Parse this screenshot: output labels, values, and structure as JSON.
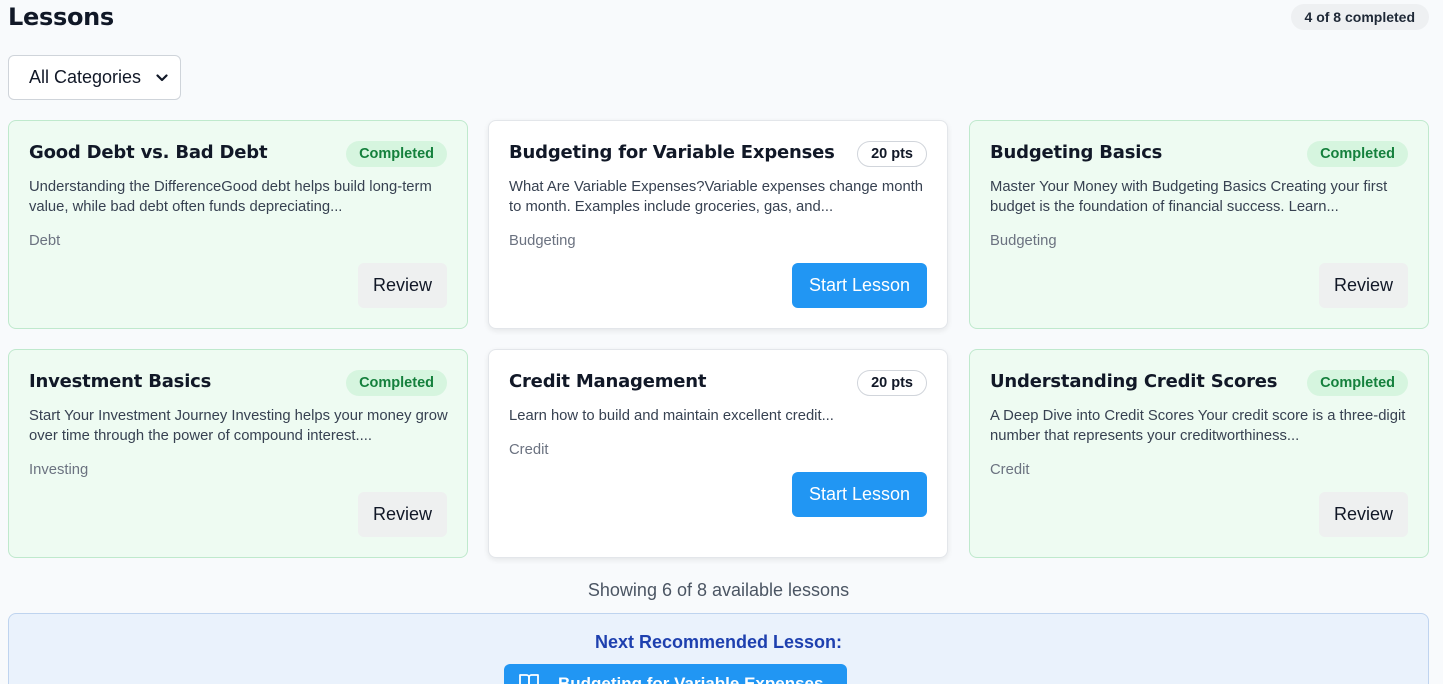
{
  "header": {
    "title": "Lessons",
    "progress": "4 of 8 completed"
  },
  "filter": {
    "selected": "All Categories"
  },
  "lessons": [
    {
      "title": "Good Debt vs. Bad Debt",
      "badge": "Completed",
      "status": "completed",
      "description": "Understanding the DifferenceGood debt helps build long-term value, while bad debt often funds depreciating...",
      "category": "Debt",
      "action": "Review"
    },
    {
      "title": "Budgeting for Variable Expenses",
      "badge": "20 pts",
      "status": "pending",
      "description": "What Are Variable Expenses?Variable expenses change month to month. Examples include groceries, gas, and...",
      "category": "Budgeting",
      "action": "Start Lesson"
    },
    {
      "title": "Budgeting Basics",
      "badge": "Completed",
      "status": "completed",
      "description": "Master Your Money with Budgeting Basics Creating your first budget is the foundation of financial success. Learn...",
      "category": "Budgeting",
      "action": "Review"
    },
    {
      "title": "Investment Basics",
      "badge": "Completed",
      "status": "completed",
      "description": "Start Your Investment Journey Investing helps your money grow over time through the power of compound interest....",
      "category": "Investing",
      "action": "Review"
    },
    {
      "title": "Credit Management",
      "badge": "20 pts",
      "status": "pending",
      "description": "Learn how to build and maintain excellent credit...",
      "category": "Credit",
      "action": "Start Lesson"
    },
    {
      "title": "Understanding Credit Scores",
      "badge": "Completed",
      "status": "completed",
      "description": "A Deep Dive into Credit Scores Your credit score is a three-digit number that represents your creditworthiness...",
      "category": "Credit",
      "action": "Review"
    }
  ],
  "footer": {
    "showing": "Showing 6 of 8 available lessons"
  },
  "recommendation": {
    "label": "Next Recommended Lesson:",
    "button": "Budgeting for Variable Expenses",
    "icon": "book-icon"
  }
}
